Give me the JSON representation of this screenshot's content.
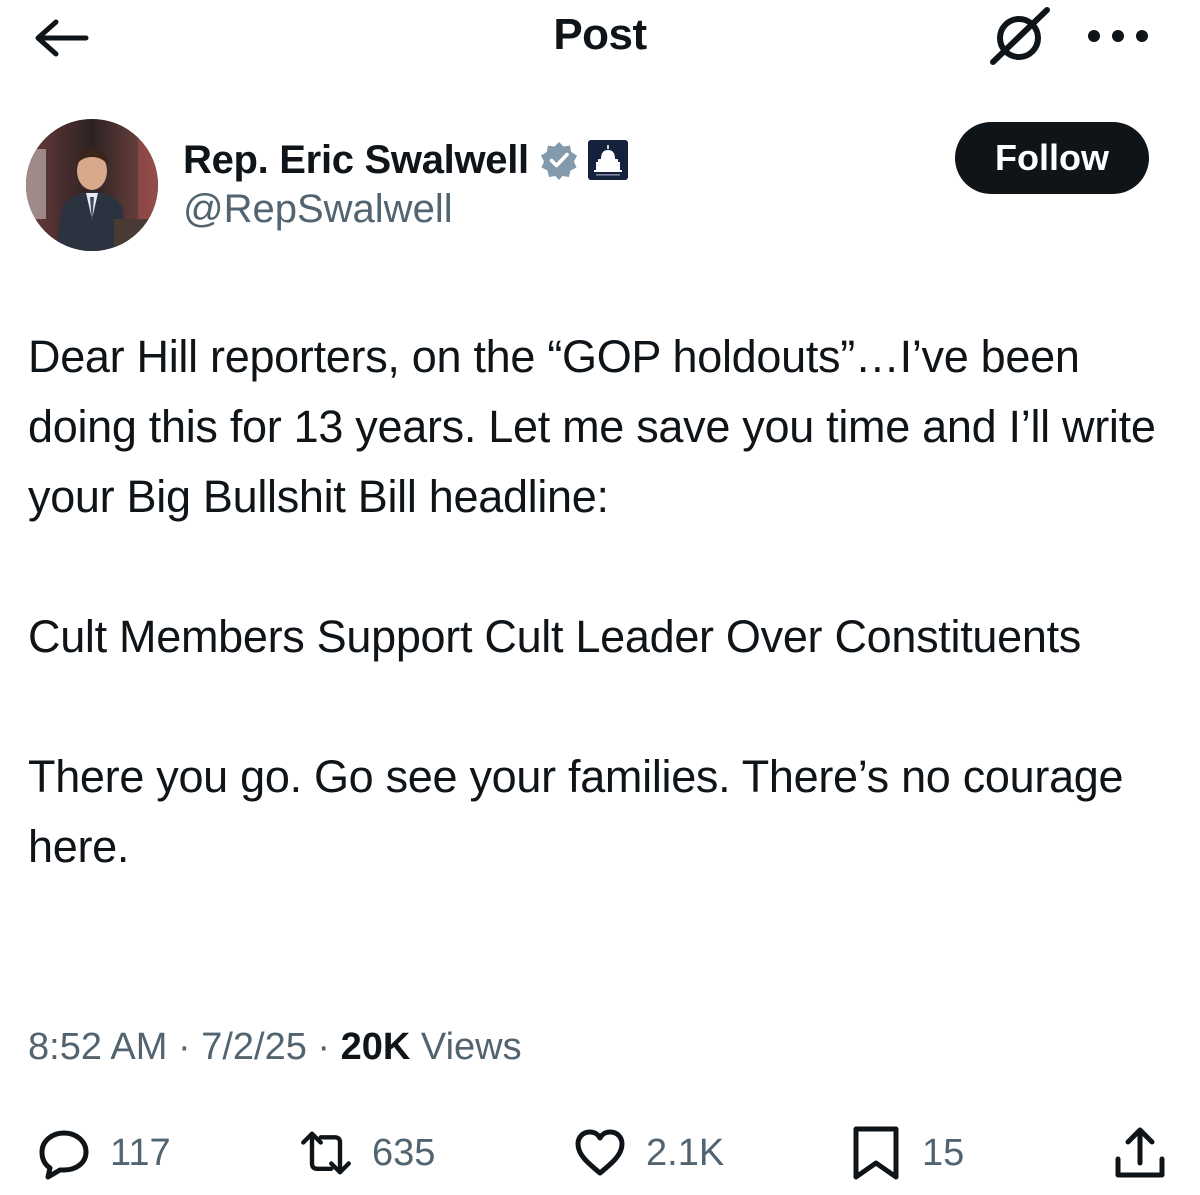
{
  "header": {
    "title": "Post",
    "back_icon": "arrow-left-icon",
    "grok_icon": "grok-icon",
    "more_icon": "more-dots-icon"
  },
  "author": {
    "name": "Rep. Eric Swalwell",
    "handle": "@RepSwalwell",
    "verified_icon": "verified-badge-icon",
    "affiliation_icon": "house-democrats-badge-icon",
    "verified_color": "#829aab",
    "follow_label": "Follow"
  },
  "post": {
    "paragraphs": [
      "Dear Hill reporters, on the “GOP holdouts”…I’ve been doing this for 13 years. Let me save you time and I’ll write your Big Bullshit Bill headline:",
      "Cult Members Support Cult Leader Over Constituents",
      "There you go. Go see your families. There’s no courage here."
    ],
    "time": "8:52 AM",
    "separator": "·",
    "date": "7/2/25",
    "views_count": "20K",
    "views_label": "Views"
  },
  "actions": {
    "replies": "117",
    "reposts": "635",
    "likes": "2.1K",
    "bookmarks": "15",
    "share_icon": "share-icon"
  },
  "colors": {
    "text": "#0f1419",
    "secondary": "#536471",
    "follow_bg": "#0f1419"
  }
}
